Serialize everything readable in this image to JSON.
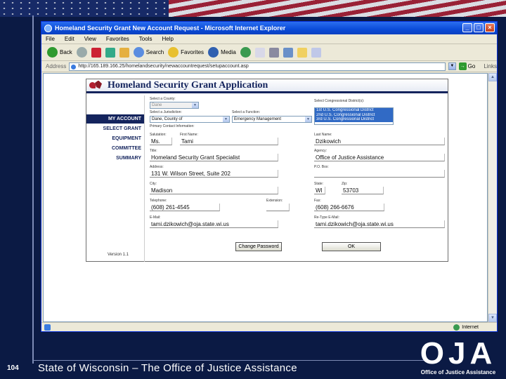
{
  "slide": {
    "number": "104",
    "footer": "State of Wisconsin – The Office of Justice Assistance",
    "logo_text": "OJA",
    "logo_caption": "Office of Justice Assistance"
  },
  "browser": {
    "title": "Homeland Security Grant New Account Request - Microsoft Internet Explorer",
    "menu": [
      "File",
      "Edit",
      "View",
      "Favorites",
      "Tools",
      "Help"
    ],
    "toolbar": {
      "back": "Back",
      "search": "Search",
      "favorites": "Favorites",
      "media": "Media"
    },
    "address_label": "Address",
    "address_value": "http://165.189.166.25/homelandsecurity/newaccountrequest/setupaccount.asp",
    "go_label": "Go",
    "links_label": "Links",
    "status_zone": "Internet"
  },
  "app": {
    "title": "Homeland Security Grant Application",
    "version": "Version 1.1",
    "menu": [
      {
        "label": "MY ACCOUNT",
        "active": true
      },
      {
        "label": "SELECT GRANT",
        "active": false
      },
      {
        "label": "EQUIPMENT",
        "active": false
      },
      {
        "label": "COMMITTEE",
        "active": false
      },
      {
        "label": "SUMMARY",
        "active": false
      }
    ],
    "form": {
      "county_label": "Select a County:",
      "county_value": "Dane",
      "jurisdiction_label": "Select a Jurisdiction:",
      "jurisdiction_value": "Dane, County of",
      "function_label": "Select a Function:",
      "function_value": "Emergency Management",
      "district_label": "Select Congressional District(s):",
      "districts": [
        "1st U.S. Congressional District",
        "2nd U.S. Congressional District",
        "3rd U.S. Congressional District"
      ],
      "contact_section": "Primary Contact Information:",
      "salutation_label": "Salutation:",
      "salutation_value": "Ms.",
      "first_name_label": "First Name:",
      "first_name_value": "Tami",
      "last_name_label": "Last Name:",
      "last_name_value": "Dzikowich",
      "title_label": "Title:",
      "title_value": "Homeland Security Grant Specialist",
      "agency_label": "Agency:",
      "agency_value": "Office of Justice Assistance",
      "address_label": "Address:",
      "address_value": "131 W. Wilson Street, Suite 202",
      "po_box_label": "P.O. Box:",
      "po_box_value": "",
      "city_label": "City:",
      "city_value": "Madison",
      "state_label": "State:",
      "state_value": "WI",
      "zip_label": "Zip:",
      "zip_value": "53703",
      "telephone_label": "Telephone:",
      "telephone_value": "(608) 261-4545",
      "extension_label": "Extension:",
      "extension_value": "",
      "fax_label": "Fax:",
      "fax_value": "(608) 266-6676",
      "email_label": "E-Mail:",
      "email_value": "tami.dzikowich@oja.state.wi.us",
      "reemail_label": "Re-Type E-Mail:",
      "reemail_value": "tami.dzikowich@oja.state.wi.us",
      "change_password_button": "Change Password",
      "ok_button": "OK"
    }
  },
  "colors": {
    "navy": "#14245d",
    "slide_bg": "#0b1a44",
    "xp_blue": "#0a4bd8"
  }
}
